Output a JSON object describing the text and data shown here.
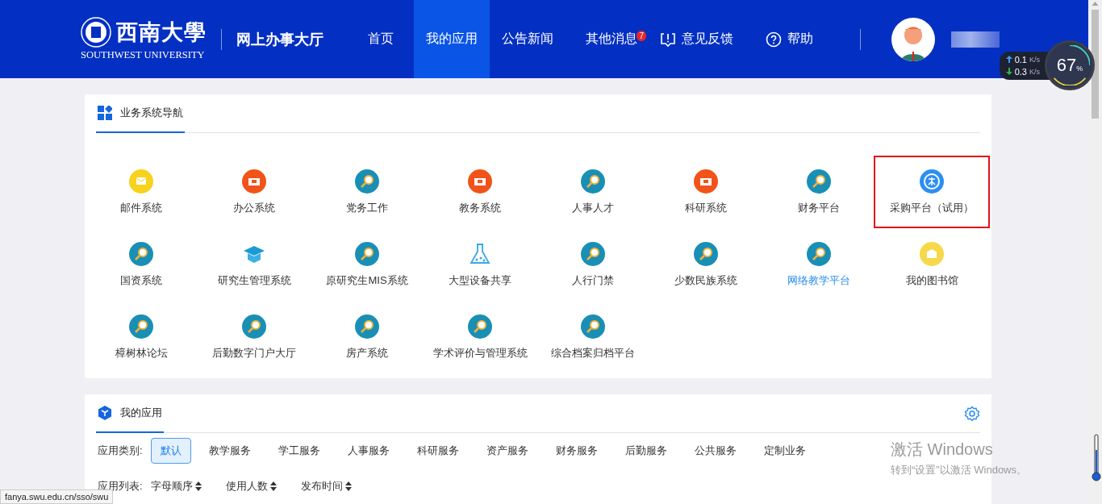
{
  "header": {
    "logo": {
      "name": "西南大學",
      "subtitle": "SOUTHWEST UNIVERSITY"
    },
    "site_title": "网上办事大厅",
    "nav": [
      {
        "label": "首页",
        "selected": false
      },
      {
        "label": "我的应用",
        "selected": true
      },
      {
        "label": "公告新闻",
        "selected": false
      },
      {
        "label": "其他消息",
        "selected": false,
        "badge": "7"
      }
    ],
    "actions": [
      {
        "kind": "feedback",
        "label": "意见反馈"
      },
      {
        "kind": "help",
        "label": "帮助"
      }
    ]
  },
  "network_widget": {
    "upload": "0.1",
    "upload_unit": "K/s",
    "download": "0.3",
    "download_unit": "K/s",
    "percent": "67",
    "percent_unit": "%"
  },
  "system_nav": {
    "tab": "业务系统导航",
    "items": [
      {
        "label": "邮件系统",
        "kind": "mail",
        "outlined": false,
        "active": false
      },
      {
        "label": "办公系统",
        "kind": "office",
        "outlined": false,
        "active": false
      },
      {
        "label": "党务工作",
        "kind": "search",
        "outlined": false,
        "active": false
      },
      {
        "label": "教务系统",
        "kind": "office",
        "outlined": false,
        "active": false
      },
      {
        "label": "人事人才",
        "kind": "search",
        "outlined": false,
        "active": false
      },
      {
        "label": "科研系统",
        "kind": "office",
        "outlined": false,
        "active": false
      },
      {
        "label": "财务平台",
        "kind": "search",
        "outlined": false,
        "active": false
      },
      {
        "label": "采购平台（试用）",
        "kind": "procure",
        "outlined": true,
        "active": false
      },
      {
        "label": "国资系统",
        "kind": "search",
        "outlined": false,
        "active": false
      },
      {
        "label": "研究生管理系统",
        "kind": "cap",
        "outlined": false,
        "active": false
      },
      {
        "label": "原研究生MIS系统",
        "kind": "search",
        "outlined": false,
        "active": false
      },
      {
        "label": "大型设备共享",
        "kind": "flask",
        "outlined": false,
        "active": false
      },
      {
        "label": "人行门禁",
        "kind": "search",
        "outlined": false,
        "active": false
      },
      {
        "label": "少数民族系统",
        "kind": "search",
        "outlined": false,
        "active": false
      },
      {
        "label": "网络教学平台",
        "kind": "search",
        "outlined": false,
        "active": true
      },
      {
        "label": "我的图书馆",
        "kind": "library",
        "outlined": false,
        "active": false
      },
      {
        "label": "樟树林论坛",
        "kind": "search",
        "outlined": false,
        "active": false
      },
      {
        "label": "后勤数字门户大厅",
        "kind": "search",
        "outlined": false,
        "active": false
      },
      {
        "label": "房产系统",
        "kind": "search",
        "outlined": false,
        "active": false
      },
      {
        "label": "学术评价与管理系统",
        "kind": "search",
        "outlined": false,
        "active": false
      },
      {
        "label": "综合档案归档平台",
        "kind": "search",
        "outlined": false,
        "active": false
      }
    ]
  },
  "my_apps": {
    "tab": "我的应用",
    "category_label": "应用类别:",
    "categories": [
      {
        "label": "默认",
        "selected": true
      },
      {
        "label": "教学服务",
        "selected": false
      },
      {
        "label": "学工服务",
        "selected": false
      },
      {
        "label": "人事服务",
        "selected": false
      },
      {
        "label": "科研服务",
        "selected": false
      },
      {
        "label": "资产服务",
        "selected": false
      },
      {
        "label": "财务服务",
        "selected": false
      },
      {
        "label": "后勤服务",
        "selected": false
      },
      {
        "label": "公共服务",
        "selected": false
      },
      {
        "label": "定制业务",
        "selected": false
      }
    ],
    "list_label": "应用列表:",
    "sorts": [
      "字母顺序",
      "使用人数",
      "发布时间"
    ]
  },
  "windows_notice": {
    "title": "激活 Windows",
    "text": "转到“设置”以激活 Windows。"
  },
  "status_url": "fanya.swu.edu.cn/sso/swu"
}
